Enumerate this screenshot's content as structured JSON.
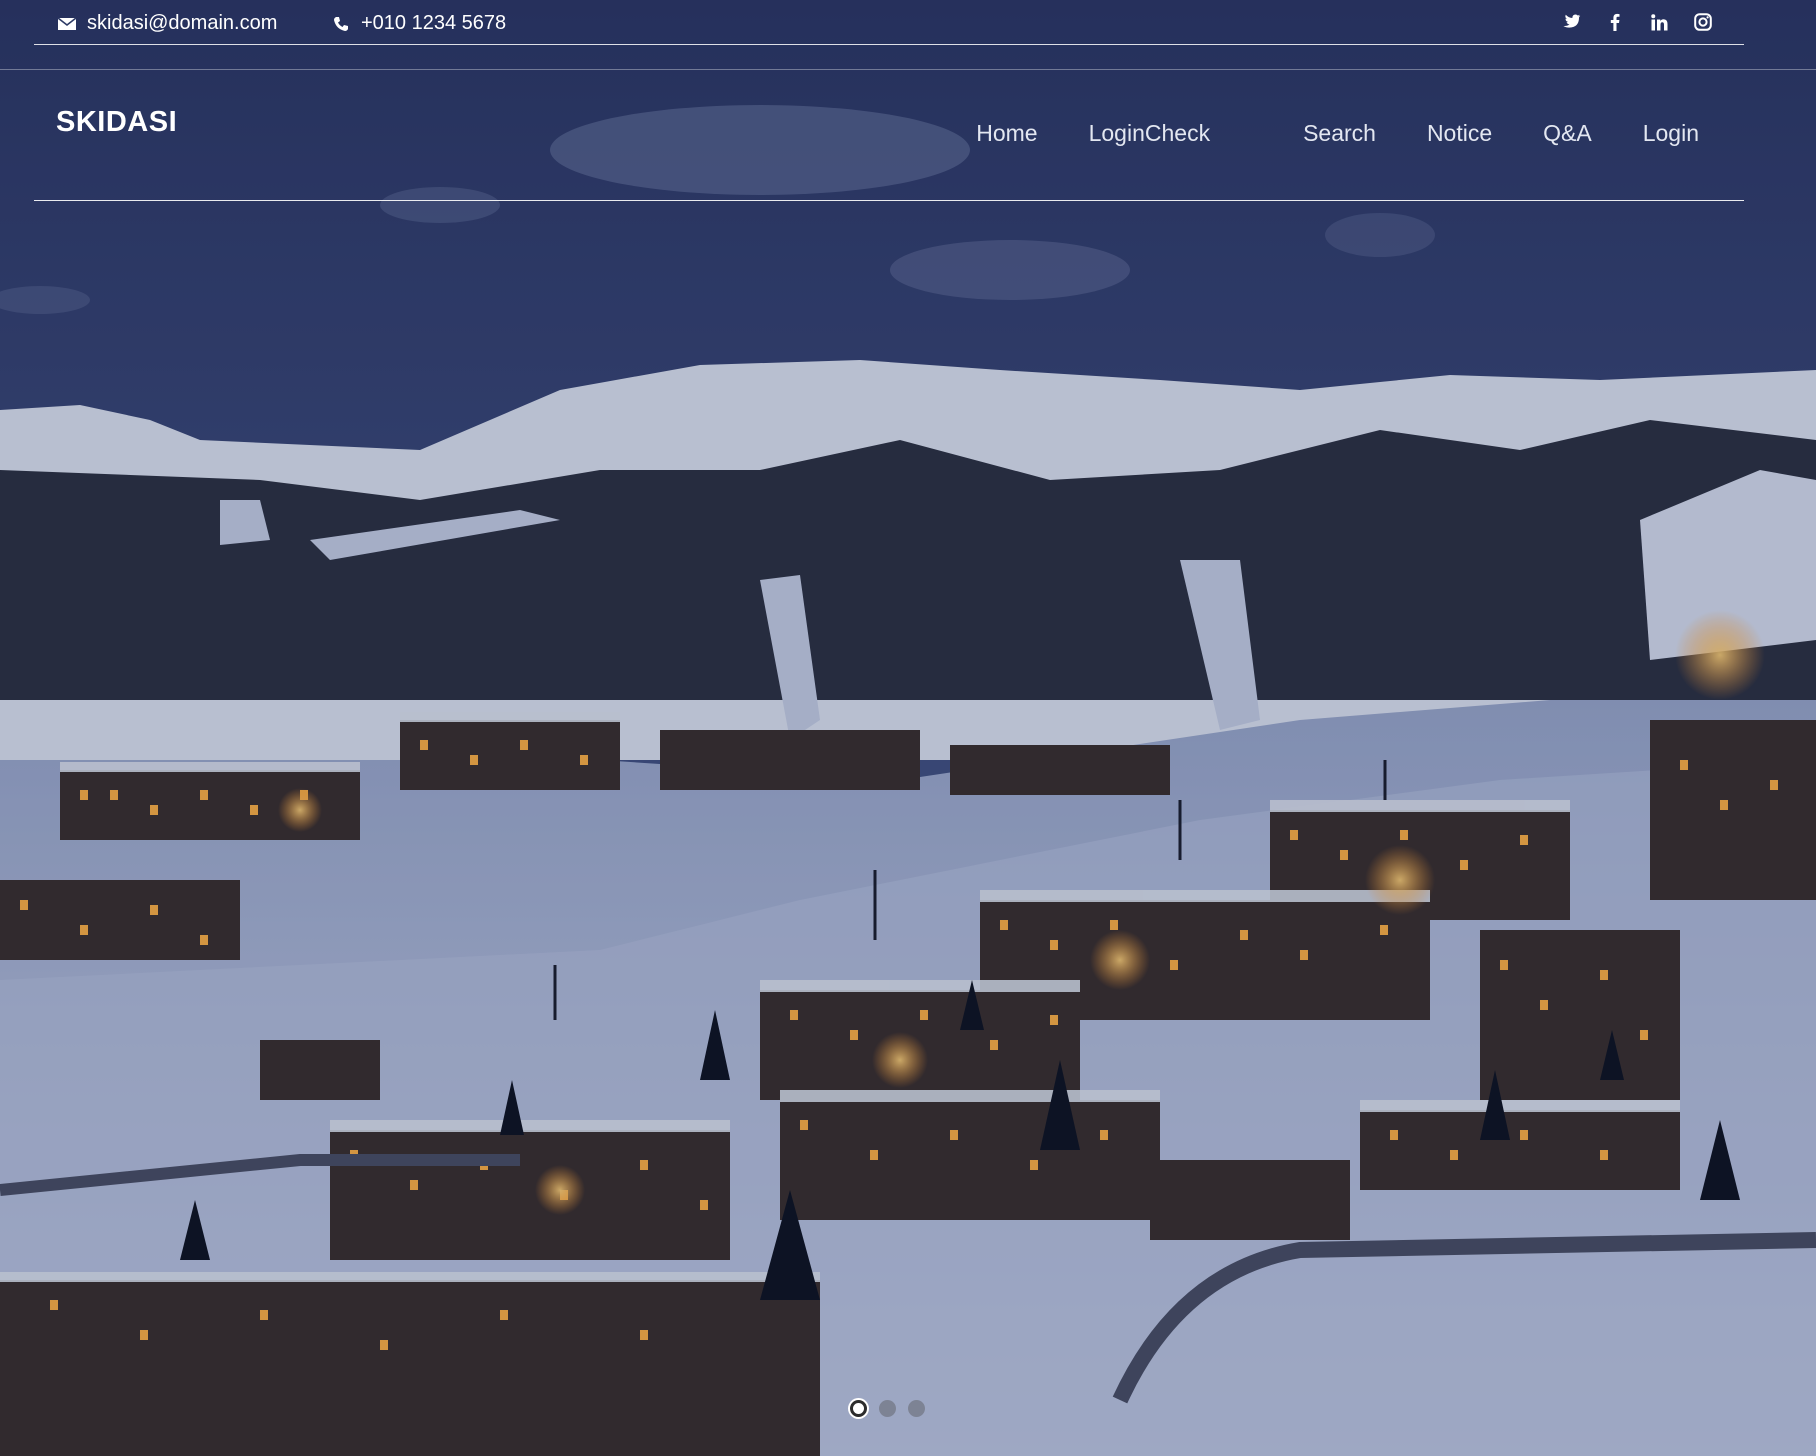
{
  "topbar": {
    "email": "skidasi@domain.com",
    "phone": "+010 1234 5678",
    "email_icon": "envelope-icon",
    "phone_icon": "phone-icon",
    "social": [
      {
        "icon": "twitter-icon"
      },
      {
        "icon": "facebook-icon"
      },
      {
        "icon": "linkedin-icon"
      },
      {
        "icon": "instagram-icon"
      }
    ]
  },
  "header": {
    "brand": "SKIDASI",
    "nav": [
      "Home",
      "LoginCheck",
      "Search",
      "Notice",
      "Q&A",
      "Login"
    ]
  },
  "hero": {
    "background": "night-ski-resort-village-photo",
    "slides": 3,
    "active_slide": 1
  },
  "colors": {
    "text": "#ffffff",
    "nav_text": "#e3e7f1",
    "sky": "#3b4a78",
    "snow": "#c9d3ea",
    "lights": "#ffb347"
  }
}
